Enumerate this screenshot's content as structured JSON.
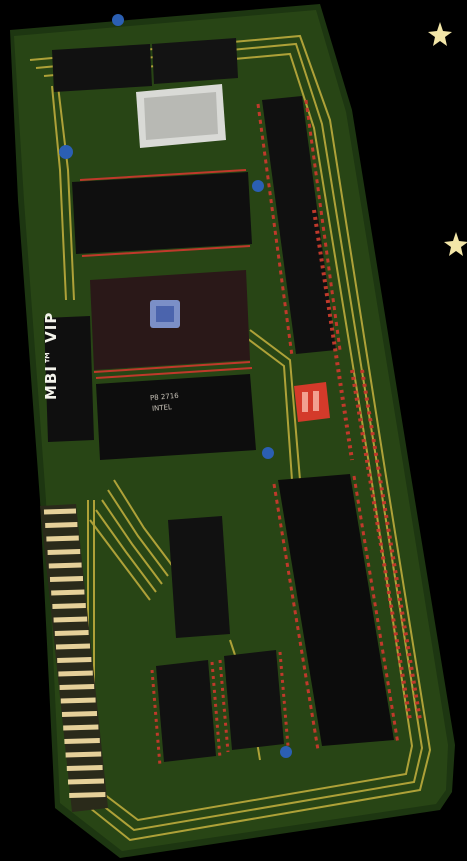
{
  "board": {
    "label": "MBI™ VIP",
    "eprom_line1": "P8 2716",
    "eprom_line2": "INTEL"
  },
  "colors": {
    "background": "#000000",
    "pcb": "#1f3a12",
    "pcb_light": "#2c4a17",
    "trace": "#c6b23f",
    "chip": "#111111",
    "pin": "#c0392b",
    "edge_gold": "#e6d19a",
    "crystal": "#d9dad6",
    "dip_switch": "#d43a2a",
    "star": "#f1e3a0"
  }
}
